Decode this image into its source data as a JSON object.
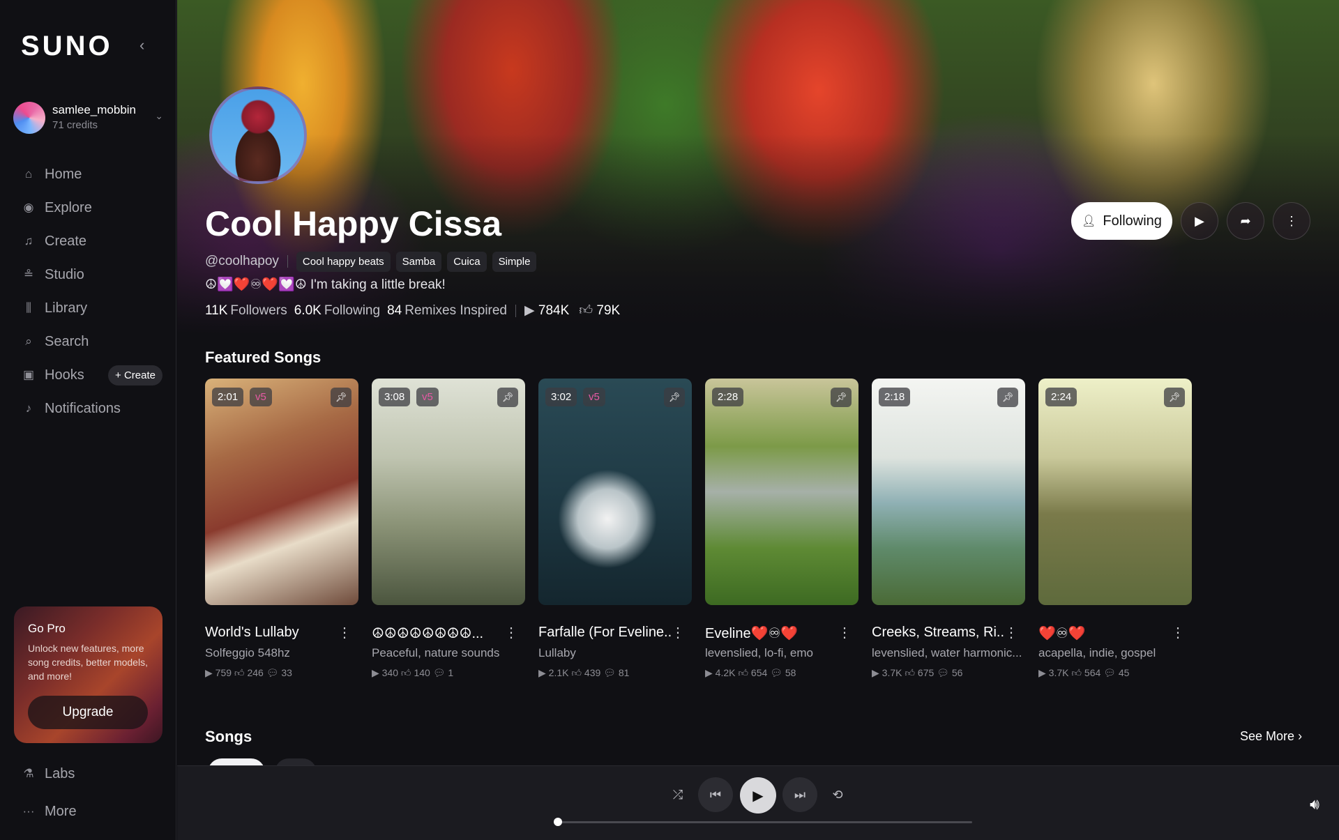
{
  "app": {
    "logo": "SUNO",
    "collapse_icon": "chevron-left-icon"
  },
  "user": {
    "name": "samlee_mobbin",
    "credits": "71 credits"
  },
  "nav": [
    {
      "label": "Home",
      "icon": "home-icon",
      "glyph": "⌂"
    },
    {
      "label": "Explore",
      "icon": "compass-icon",
      "glyph": "◉"
    },
    {
      "label": "Create",
      "icon": "music-note-icon",
      "glyph": "♫"
    },
    {
      "label": "Studio",
      "icon": "sliders-icon",
      "glyph": "≗"
    },
    {
      "label": "Library",
      "icon": "library-icon",
      "glyph": "⫼"
    },
    {
      "label": "Search",
      "icon": "search-icon",
      "glyph": "⌕"
    },
    {
      "label": "Hooks",
      "icon": "hooks-icon",
      "glyph": "▣"
    },
    {
      "label": "Notifications",
      "icon": "bell-icon",
      "glyph": "♪"
    }
  ],
  "hooks_create": "+ Create",
  "gopro": {
    "title": "Go Pro",
    "text": "Unlock new features, more song credits, better models, and more!",
    "button": "Upgrade"
  },
  "bottom_nav": [
    {
      "label": "Labs",
      "icon": "flask-icon",
      "glyph": "⚗"
    },
    {
      "label": "More",
      "icon": "more-horizontal-icon",
      "glyph": "···"
    }
  ],
  "profile": {
    "name": "Cool Happy Cissa",
    "handle": "@coolhapoy",
    "tags": [
      "Cool happy beats",
      "Samba",
      "Cuica",
      "Simple"
    ],
    "bio": "☮💟❤️♾❤️💟☮ I'm taking a little break!",
    "followers_num": "11K",
    "followers_label": "Followers",
    "following_num": "6.0K",
    "following_label": "Following",
    "remixes_num": "84",
    "remixes_label": "Remixes Inspired",
    "plays": "784K",
    "likes": "79K",
    "following_button": "Following"
  },
  "featured_title": "Featured Songs",
  "songs": [
    {
      "duration": "2:01",
      "version": "v5",
      "title": "World's Lullaby",
      "subtitle": "Solfeggio 548hz",
      "plays": "759",
      "likes": "246",
      "comments": "33",
      "bg": "linear-gradient(160deg,#d9b27a 0%,#a76a45 30%,#8a3b2e 55%,#e8dcc8 70%,#6e4a3a 100%)"
    },
    {
      "duration": "3:08",
      "version": "v5",
      "title": "☮☮☮☮☮☮☮☮...",
      "subtitle": "Peaceful, nature sounds",
      "plays": "340",
      "likes": "140",
      "comments": "1",
      "bg": "linear-gradient(180deg,#dfe2d6 0%,#bfc4b0 35%,#8a9276 65%,#4b553e 100%)"
    },
    {
      "duration": "3:02",
      "version": "v5",
      "title": "Farfalle (For Eveline...",
      "subtitle": "Lullaby",
      "plays": "2.1K",
      "likes": "439",
      "comments": "81",
      "bg": "radial-gradient(circle at 45% 62%,#f2f2f2 0%,#b9c4c8 18%,rgba(0,0,0,0) 30%),linear-gradient(180deg,#2a4a55 0%,#1f3a45 50%,#14262e 100%)"
    },
    {
      "duration": "2:28",
      "version": "",
      "title": "Eveline❤️♾❤️",
      "subtitle": "levenslied, lo-fi, emo",
      "plays": "4.2K",
      "likes": "654",
      "comments": "58",
      "bg": "linear-gradient(180deg,#c9c59a 0%,#7c9a48 30%,#a6b0a8 50%,#5e8a34 75%,#3d6a22 100%)"
    },
    {
      "duration": "2:18",
      "version": "",
      "title": "Creeks, Streams, Ri...",
      "subtitle": "levenslied, water harmonic...",
      "plays": "3.7K",
      "likes": "675",
      "comments": "56",
      "bg": "linear-gradient(180deg,#f4f5f2 0%,#dde3de 35%,#8fb0b4 55%,#5f8a6a 75%,#4a6a36 100%)"
    },
    {
      "duration": "2:24",
      "version": "",
      "title": "❤️♾❤️",
      "subtitle": "acapella, indie, gospel",
      "plays": "3.7K",
      "likes": "564",
      "comments": "45",
      "bg": "linear-gradient(180deg,#eef0c8 0%,#c9c89a 35%,#7a7a4a 60%,#5e6a3c 100%)"
    }
  ],
  "songs_title": "Songs",
  "see_more": "See More",
  "player": {
    "progress_fraction": 0.01
  }
}
